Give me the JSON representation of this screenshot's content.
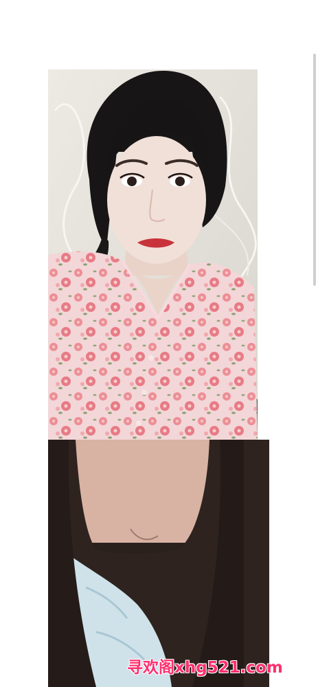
{
  "images": [
    {
      "description_icon": "portrait-photo-floral-dress"
    },
    {
      "description_icon": "photo-dark-top"
    }
  ],
  "watermark": {
    "text": "寻欢阁xhg521.com",
    "color": "#ff2f6d"
  },
  "colors": {
    "background": "#ffffff",
    "scrollbar": "#cfcfcf"
  }
}
